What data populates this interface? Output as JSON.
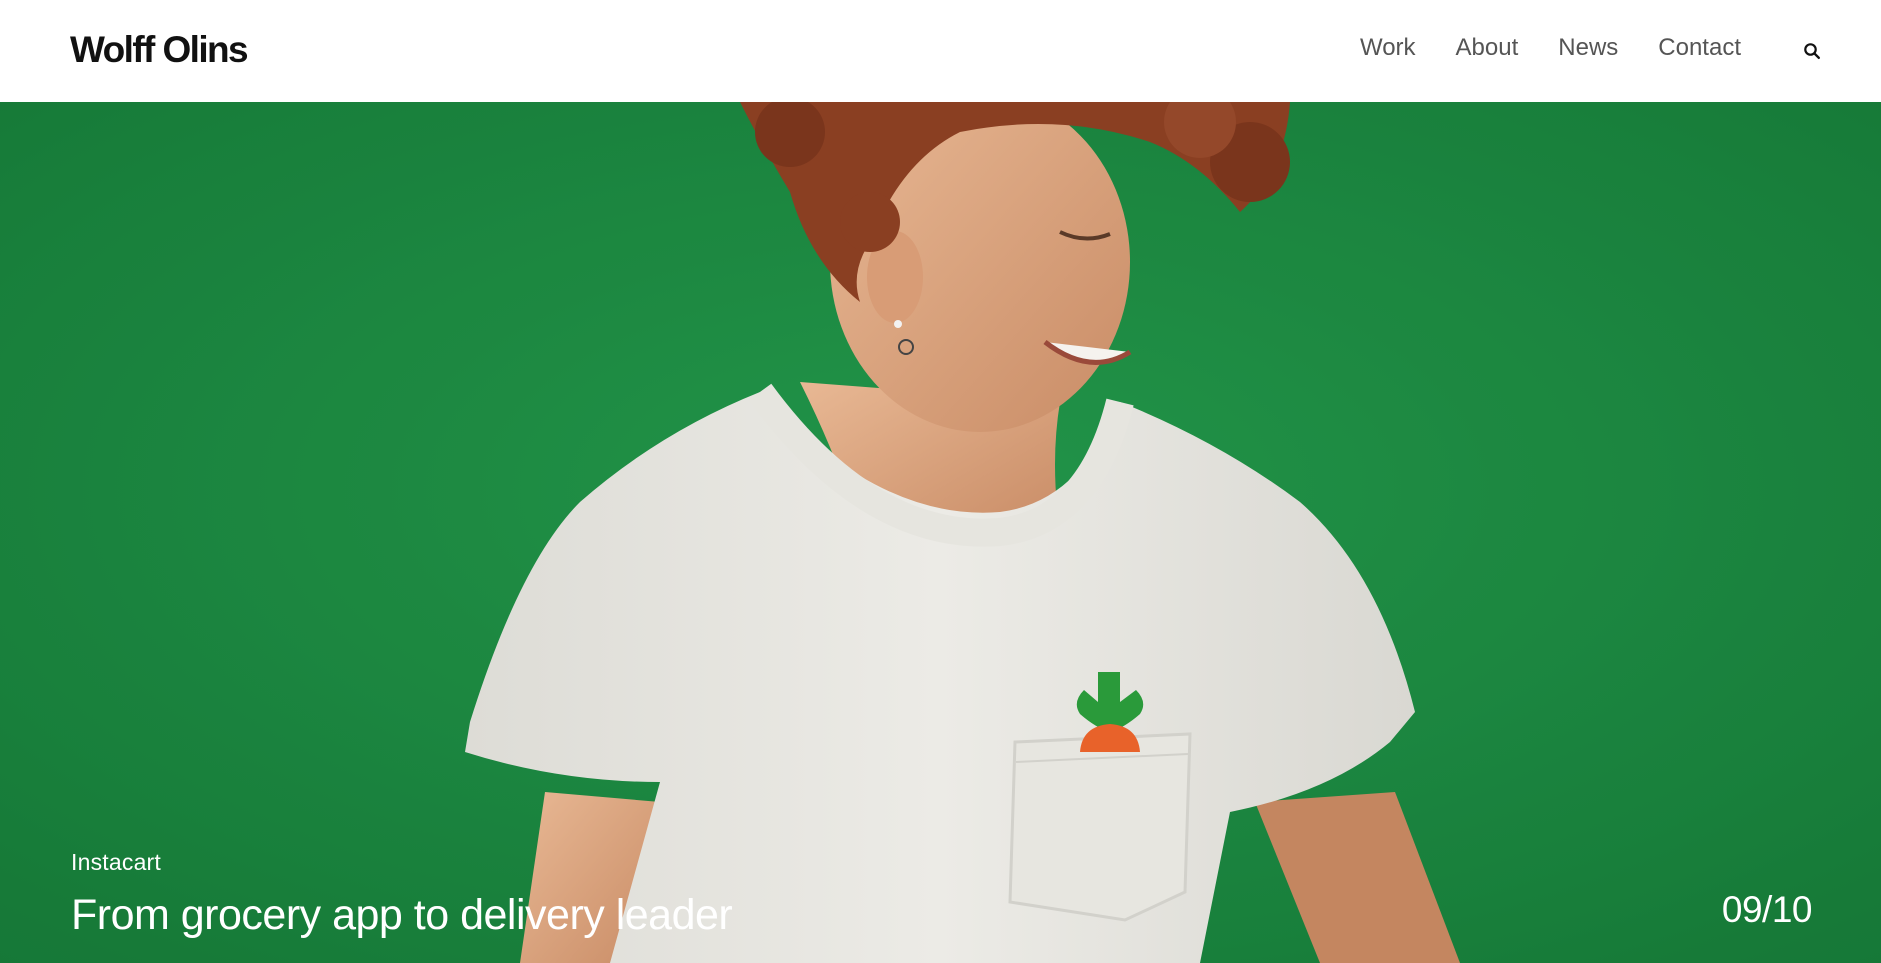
{
  "header": {
    "logo": "Wolff Olins",
    "nav": [
      {
        "label": "Work"
      },
      {
        "label": "About"
      },
      {
        "label": "News"
      },
      {
        "label": "Contact"
      }
    ],
    "search_icon": "search-icon"
  },
  "hero": {
    "client": "Instacart",
    "headline": "From grocery app to delivery leader",
    "counter": "09/10",
    "image": "Person in white t-shirt with carrot logo against green wall",
    "colors": {
      "background": "#1f8b43",
      "carrot_leaf": "#2a9a3a",
      "carrot_root": "#e8622a"
    }
  }
}
